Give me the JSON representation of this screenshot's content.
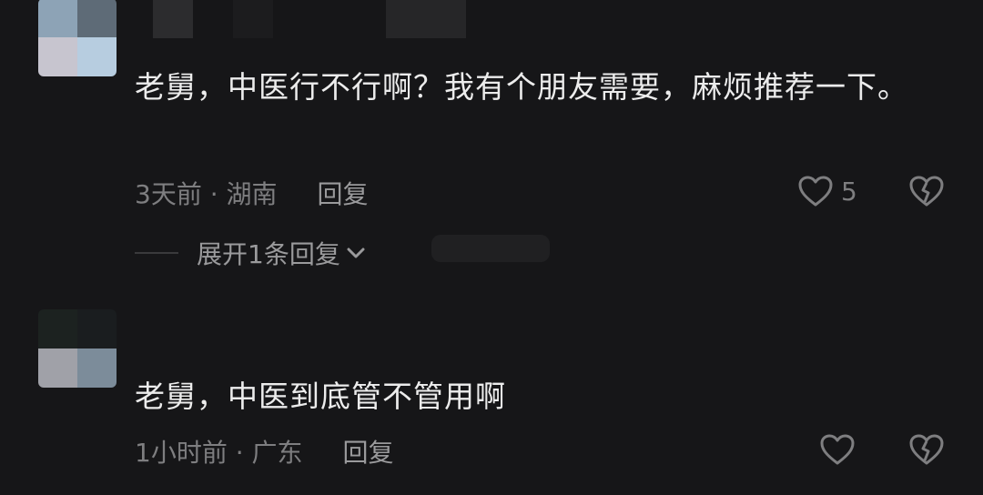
{
  "comments": [
    {
      "text": "老舅，中医行不行啊？我有个朋友需要，麻烦推荐一下。",
      "time_location": "3天前 · 湖南",
      "reply_label": "回复",
      "like_count": "5",
      "expand_label": "展开1条回复"
    },
    {
      "text": "老舅，中医到底管不管用啊",
      "time_location": "1小时前 · 广东",
      "reply_label": "回复",
      "like_count": ""
    }
  ],
  "icons": {
    "like": "heart-outline-icon",
    "dislike": "broken-heart-icon",
    "expand": "chevron-down-icon"
  },
  "colors": {
    "background": "#161618",
    "text": "#ececec",
    "meta": "#7e7e80"
  }
}
